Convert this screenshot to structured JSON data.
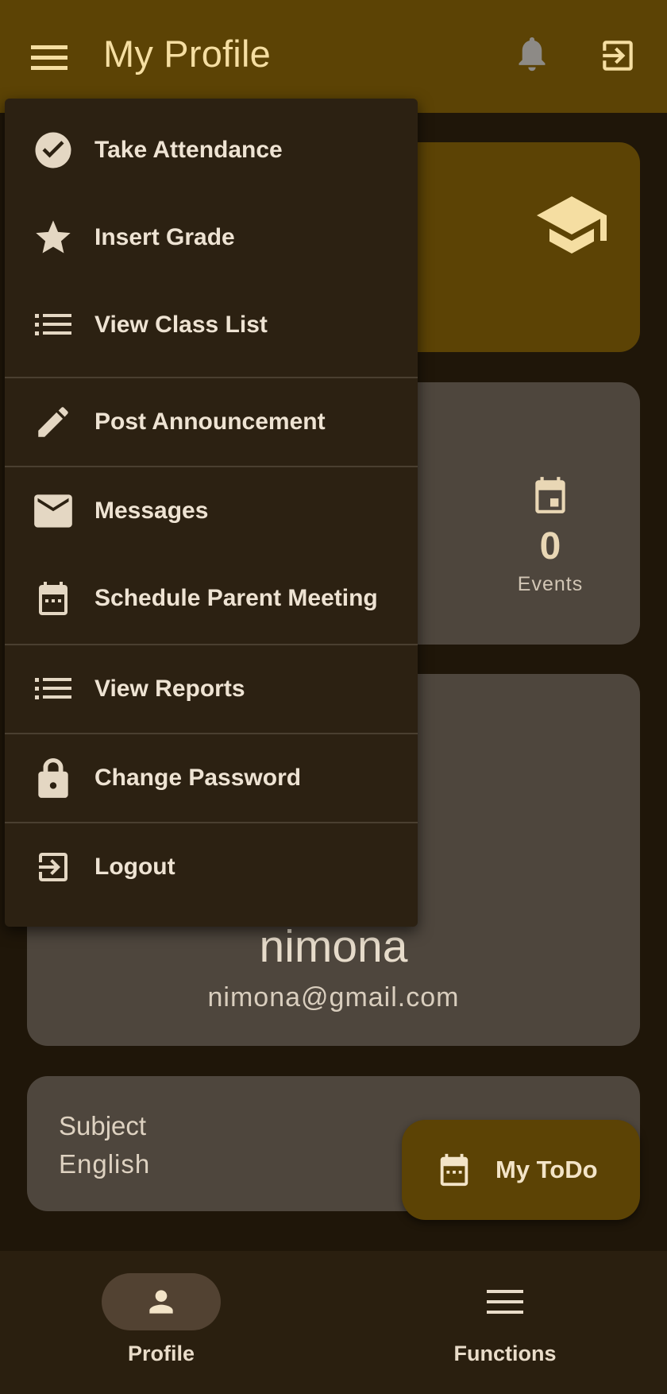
{
  "header": {
    "title": "My Profile",
    "menu_icon": "menu-icon",
    "notification_icon": "bell-icon",
    "exit_icon": "exit-icon"
  },
  "hero_card": {
    "icon": "graduation-cap-icon"
  },
  "stats_card": {
    "events": {
      "icon": "calendar-icon",
      "value": "0",
      "label": "Events"
    }
  },
  "user_card": {
    "name": "nimona",
    "email": "nimona@gmail.com"
  },
  "subject_card": {
    "label": "Subject",
    "value": "English"
  },
  "fab": {
    "icon": "calendar-icon",
    "label": "My ToDo"
  },
  "drawer": {
    "items": [
      {
        "label": "Take Attendance",
        "icon": "check-circle-icon"
      },
      {
        "label": "Insert Grade",
        "icon": "star-icon"
      },
      {
        "label": "View Class List",
        "icon": "list-icon"
      },
      {
        "label": "Post Announcement",
        "icon": "pencil-icon"
      },
      {
        "label": "Messages",
        "icon": "mail-icon"
      },
      {
        "label": "Schedule Parent Meeting",
        "icon": "calendar-icon"
      },
      {
        "label": "View Reports",
        "icon": "list-icon"
      },
      {
        "label": "Change Password",
        "icon": "lock-icon"
      },
      {
        "label": "Logout",
        "icon": "exit-icon"
      }
    ]
  },
  "bottom_nav": {
    "items": [
      {
        "label": "Profile",
        "icon": "person-icon",
        "active": true
      },
      {
        "label": "Functions",
        "icon": "menu-icon",
        "active": false
      }
    ]
  },
  "colors": {
    "primary": "#5c4305",
    "background": "#1f1609",
    "surface": "#4e463d",
    "drawer": "#2c2112",
    "on_primary": "#f5dea2"
  }
}
